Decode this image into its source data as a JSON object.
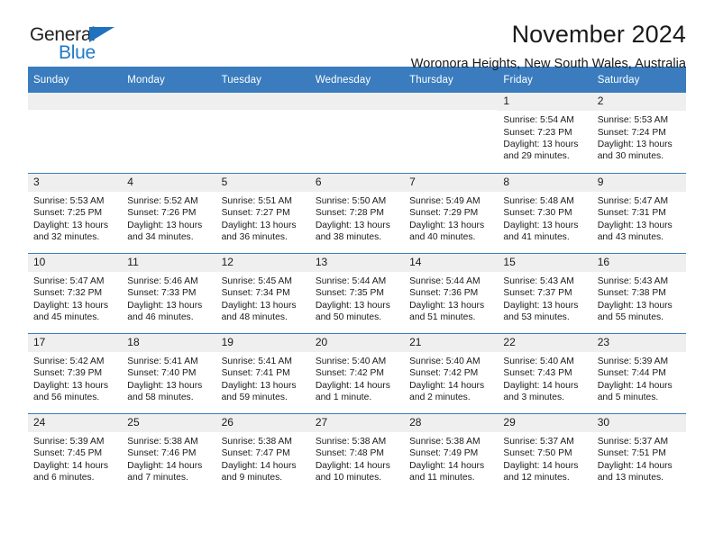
{
  "brand": {
    "name_top": "General",
    "name_bottom": "Blue",
    "triangle_color": "#1f72bd",
    "blue_color": "#1f7ac4"
  },
  "header": {
    "title": "November 2024",
    "subtitle": "Woronora Heights, New South Wales, Australia"
  },
  "theme": {
    "header_blue": "#3a7cbe",
    "daynum_gray": "#efefef",
    "text": "#1a1a1a"
  },
  "labels": {
    "sunrise_prefix": "Sunrise:",
    "sunset_prefix": "Sunset:",
    "daylight_prefix": "Daylight:"
  },
  "weekdays": [
    "Sunday",
    "Monday",
    "Tuesday",
    "Wednesday",
    "Thursday",
    "Friday",
    "Saturday"
  ],
  "weeks": [
    [
      {
        "day": "",
        "empty": true
      },
      {
        "day": "",
        "empty": true
      },
      {
        "day": "",
        "empty": true
      },
      {
        "day": "",
        "empty": true
      },
      {
        "day": "",
        "empty": true
      },
      {
        "day": "1",
        "sunrise": "Sunrise: 5:54 AM",
        "sunset": "Sunset: 7:23 PM",
        "daylight": "Daylight: 13 hours and 29 minutes."
      },
      {
        "day": "2",
        "sunrise": "Sunrise: 5:53 AM",
        "sunset": "Sunset: 7:24 PM",
        "daylight": "Daylight: 13 hours and 30 minutes."
      }
    ],
    [
      {
        "day": "3",
        "sunrise": "Sunrise: 5:53 AM",
        "sunset": "Sunset: 7:25 PM",
        "daylight": "Daylight: 13 hours and 32 minutes."
      },
      {
        "day": "4",
        "sunrise": "Sunrise: 5:52 AM",
        "sunset": "Sunset: 7:26 PM",
        "daylight": "Daylight: 13 hours and 34 minutes."
      },
      {
        "day": "5",
        "sunrise": "Sunrise: 5:51 AM",
        "sunset": "Sunset: 7:27 PM",
        "daylight": "Daylight: 13 hours and 36 minutes."
      },
      {
        "day": "6",
        "sunrise": "Sunrise: 5:50 AM",
        "sunset": "Sunset: 7:28 PM",
        "daylight": "Daylight: 13 hours and 38 minutes."
      },
      {
        "day": "7",
        "sunrise": "Sunrise: 5:49 AM",
        "sunset": "Sunset: 7:29 PM",
        "daylight": "Daylight: 13 hours and 40 minutes."
      },
      {
        "day": "8",
        "sunrise": "Sunrise: 5:48 AM",
        "sunset": "Sunset: 7:30 PM",
        "daylight": "Daylight: 13 hours and 41 minutes."
      },
      {
        "day": "9",
        "sunrise": "Sunrise: 5:47 AM",
        "sunset": "Sunset: 7:31 PM",
        "daylight": "Daylight: 13 hours and 43 minutes."
      }
    ],
    [
      {
        "day": "10",
        "sunrise": "Sunrise: 5:47 AM",
        "sunset": "Sunset: 7:32 PM",
        "daylight": "Daylight: 13 hours and 45 minutes."
      },
      {
        "day": "11",
        "sunrise": "Sunrise: 5:46 AM",
        "sunset": "Sunset: 7:33 PM",
        "daylight": "Daylight: 13 hours and 46 minutes."
      },
      {
        "day": "12",
        "sunrise": "Sunrise: 5:45 AM",
        "sunset": "Sunset: 7:34 PM",
        "daylight": "Daylight: 13 hours and 48 minutes."
      },
      {
        "day": "13",
        "sunrise": "Sunrise: 5:44 AM",
        "sunset": "Sunset: 7:35 PM",
        "daylight": "Daylight: 13 hours and 50 minutes."
      },
      {
        "day": "14",
        "sunrise": "Sunrise: 5:44 AM",
        "sunset": "Sunset: 7:36 PM",
        "daylight": "Daylight: 13 hours and 51 minutes."
      },
      {
        "day": "15",
        "sunrise": "Sunrise: 5:43 AM",
        "sunset": "Sunset: 7:37 PM",
        "daylight": "Daylight: 13 hours and 53 minutes."
      },
      {
        "day": "16",
        "sunrise": "Sunrise: 5:43 AM",
        "sunset": "Sunset: 7:38 PM",
        "daylight": "Daylight: 13 hours and 55 minutes."
      }
    ],
    [
      {
        "day": "17",
        "sunrise": "Sunrise: 5:42 AM",
        "sunset": "Sunset: 7:39 PM",
        "daylight": "Daylight: 13 hours and 56 minutes."
      },
      {
        "day": "18",
        "sunrise": "Sunrise: 5:41 AM",
        "sunset": "Sunset: 7:40 PM",
        "daylight": "Daylight: 13 hours and 58 minutes."
      },
      {
        "day": "19",
        "sunrise": "Sunrise: 5:41 AM",
        "sunset": "Sunset: 7:41 PM",
        "daylight": "Daylight: 13 hours and 59 minutes."
      },
      {
        "day": "20",
        "sunrise": "Sunrise: 5:40 AM",
        "sunset": "Sunset: 7:42 PM",
        "daylight": "Daylight: 14 hours and 1 minute."
      },
      {
        "day": "21",
        "sunrise": "Sunrise: 5:40 AM",
        "sunset": "Sunset: 7:42 PM",
        "daylight": "Daylight: 14 hours and 2 minutes."
      },
      {
        "day": "22",
        "sunrise": "Sunrise: 5:40 AM",
        "sunset": "Sunset: 7:43 PM",
        "daylight": "Daylight: 14 hours and 3 minutes."
      },
      {
        "day": "23",
        "sunrise": "Sunrise: 5:39 AM",
        "sunset": "Sunset: 7:44 PM",
        "daylight": "Daylight: 14 hours and 5 minutes."
      }
    ],
    [
      {
        "day": "24",
        "sunrise": "Sunrise: 5:39 AM",
        "sunset": "Sunset: 7:45 PM",
        "daylight": "Daylight: 14 hours and 6 minutes."
      },
      {
        "day": "25",
        "sunrise": "Sunrise: 5:38 AM",
        "sunset": "Sunset: 7:46 PM",
        "daylight": "Daylight: 14 hours and 7 minutes."
      },
      {
        "day": "26",
        "sunrise": "Sunrise: 5:38 AM",
        "sunset": "Sunset: 7:47 PM",
        "daylight": "Daylight: 14 hours and 9 minutes."
      },
      {
        "day": "27",
        "sunrise": "Sunrise: 5:38 AM",
        "sunset": "Sunset: 7:48 PM",
        "daylight": "Daylight: 14 hours and 10 minutes."
      },
      {
        "day": "28",
        "sunrise": "Sunrise: 5:38 AM",
        "sunset": "Sunset: 7:49 PM",
        "daylight": "Daylight: 14 hours and 11 minutes."
      },
      {
        "day": "29",
        "sunrise": "Sunrise: 5:37 AM",
        "sunset": "Sunset: 7:50 PM",
        "daylight": "Daylight: 14 hours and 12 minutes."
      },
      {
        "day": "30",
        "sunrise": "Sunrise: 5:37 AM",
        "sunset": "Sunset: 7:51 PM",
        "daylight": "Daylight: 14 hours and 13 minutes."
      }
    ]
  ]
}
